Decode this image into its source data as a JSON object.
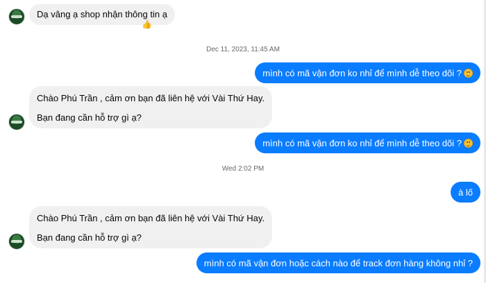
{
  "messages": {
    "m1": {
      "text": "Dạ vâng ạ shop nhận thông tin ạ",
      "reaction": "👍"
    },
    "ts1": "Dec 11, 2023, 11:45 AM",
    "m2": {
      "text": "mình có mã vận đơn ko nhỉ để mình dễ theo dõi ?",
      "emoji": "smiling-face-icon"
    },
    "m3": {
      "line1": "Chào Phú Trần , cảm ơn bạn đã liên hệ với Vài Thứ Hay.",
      "line2": "Bạn đang cần hỗ trợ gì ạ?"
    },
    "m4": {
      "text": "mình có mã vận đơn ko nhỉ để mình dễ theo dõi ?",
      "emoji": "smiling-face-icon"
    },
    "ts2": "Wed 2:02 PM",
    "m5": {
      "text": "à lố"
    },
    "m6": {
      "line1": "Chào Phú Trần , cảm ơn bạn đã liên hệ với Vài Thứ Hay.",
      "line2": "Bạn đang cần hỗ trợ gì ạ?"
    },
    "m7": {
      "text": "mình có mã vận đơn hoặc cách nào để track đơn hàng không nhỉ ?"
    }
  },
  "colors": {
    "outgoing": "#0a7cff",
    "incoming": "#f0f0f0",
    "timestamp": "#65676b"
  }
}
